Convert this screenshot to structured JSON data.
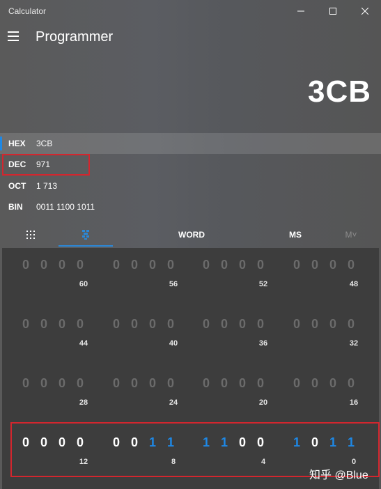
{
  "window": {
    "title": "Calculator"
  },
  "header": {
    "mode": "Programmer"
  },
  "display": {
    "value": "3CB"
  },
  "radix": [
    {
      "label": "HEX",
      "value": "3CB"
    },
    {
      "label": "DEC",
      "value": "971"
    },
    {
      "label": "OCT",
      "value": "1 713"
    },
    {
      "label": "BIN",
      "value": "0011 1100 1011"
    }
  ],
  "toolbar": {
    "word": "WORD",
    "ms": "MS",
    "mdown": "M˅"
  },
  "bits": {
    "row0": [
      "0",
      "0",
      "0",
      "0",
      "0",
      "0",
      "0",
      "0",
      "0",
      "0",
      "0",
      "0",
      "0",
      "0",
      "0",
      "0"
    ],
    "row1": [
      "0",
      "0",
      "0",
      "0",
      "0",
      "0",
      "0",
      "0",
      "0",
      "0",
      "0",
      "0",
      "0",
      "0",
      "0",
      "0"
    ],
    "row2": [
      "0",
      "0",
      "0",
      "0",
      "0",
      "0",
      "0",
      "0",
      "0",
      "0",
      "0",
      "0",
      "0",
      "0",
      "0",
      "0"
    ],
    "row3": [
      "0",
      "0",
      "0",
      "0",
      "0",
      "0",
      "1",
      "1",
      "1",
      "1",
      "0",
      "0",
      "1",
      "0",
      "1",
      "1"
    ]
  },
  "positions": {
    "row0": [
      "60",
      "56",
      "52",
      "48"
    ],
    "row1": [
      "44",
      "40",
      "36",
      "32"
    ],
    "row2": [
      "28",
      "24",
      "20",
      "16"
    ],
    "row3": [
      "12",
      "8",
      "4",
      "0"
    ]
  },
  "colors": {
    "accent": "#1e88e5",
    "highlight": "#d3262e"
  },
  "watermark": "知乎 @Blue"
}
